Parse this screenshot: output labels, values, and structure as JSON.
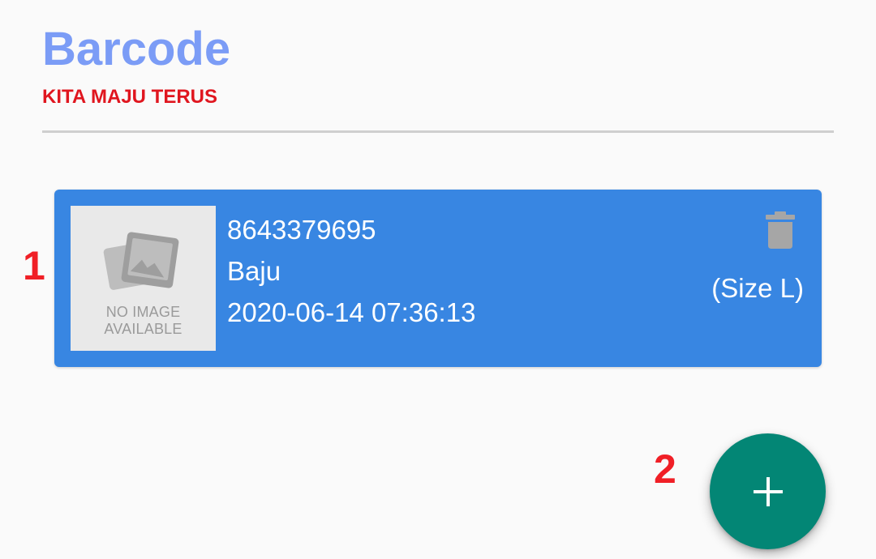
{
  "header": {
    "title": "Barcode",
    "subtitle": "KITA MAJU TERUS"
  },
  "markers": [
    "1",
    "2"
  ],
  "items": [
    {
      "image_placeholder": [
        "NO IMAGE",
        "AVAILABLE"
      ],
      "code": "8643379695",
      "name": "Baju",
      "datetime": "2020-06-14 07:36:13",
      "size": "(Size L)",
      "delete_icon": "trash-icon"
    }
  ],
  "fab": {
    "icon": "plus-icon"
  },
  "colors": {
    "title": "#7b9cf6",
    "subtitle": "#e0161f",
    "card": "#3886e2",
    "fab": "#038675",
    "marker": "#f01f26"
  }
}
